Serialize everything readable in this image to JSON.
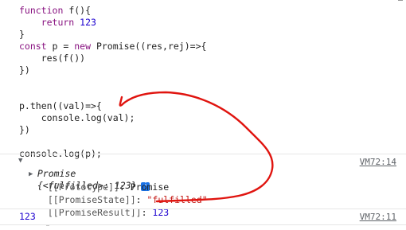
{
  "code_lines": [
    {
      "parts": [
        {
          "t": "function ",
          "c": "kw"
        },
        {
          "t": "f(){",
          "c": "txt"
        }
      ]
    },
    {
      "parts": [
        {
          "t": "    return ",
          "c": "kw"
        },
        {
          "t": "123",
          "c": "num"
        }
      ]
    },
    {
      "parts": [
        {
          "t": "}",
          "c": "txt"
        }
      ]
    },
    {
      "parts": [
        {
          "t": "const ",
          "c": "kw"
        },
        {
          "t": "p = ",
          "c": "txt"
        },
        {
          "t": "new ",
          "c": "kw"
        },
        {
          "t": "Promise((res,rej)=>{",
          "c": "txt"
        }
      ]
    },
    {
      "parts": [
        {
          "t": "    res(f())",
          "c": "txt"
        }
      ]
    },
    {
      "parts": [
        {
          "t": "})",
          "c": "txt"
        }
      ]
    },
    {
      "parts": []
    },
    {
      "parts": []
    },
    {
      "parts": [
        {
          "t": "p.then((val)=>{",
          "c": "txt"
        }
      ]
    },
    {
      "parts": [
        {
          "t": "    console.log(val);",
          "c": "txt"
        }
      ]
    },
    {
      "parts": [
        {
          "t": "})",
          "c": "txt"
        }
      ]
    },
    {
      "parts": []
    },
    {
      "parts": [
        {
          "t": "console.log(p);",
          "c": "txt"
        }
      ]
    }
  ],
  "console": {
    "promise_label": "Promise",
    "promise_state_summary": "{<fulfilled>: 123}",
    "info_badge": "i",
    "source_1": "VM72:14",
    "prototype_key": "[[Prototype]]",
    "prototype_value": "Promise",
    "state_key": "[[PromiseState]]",
    "state_value": "\"fulfilled\"",
    "result_key": "[[PromiseResult]]",
    "result_value": "123",
    "log_value": "123",
    "source_2": "VM72:11"
  },
  "colors": {
    "annotation": "#e0140f",
    "keyword": "#881280",
    "number": "#1c00cf",
    "string": "#c41a16"
  }
}
